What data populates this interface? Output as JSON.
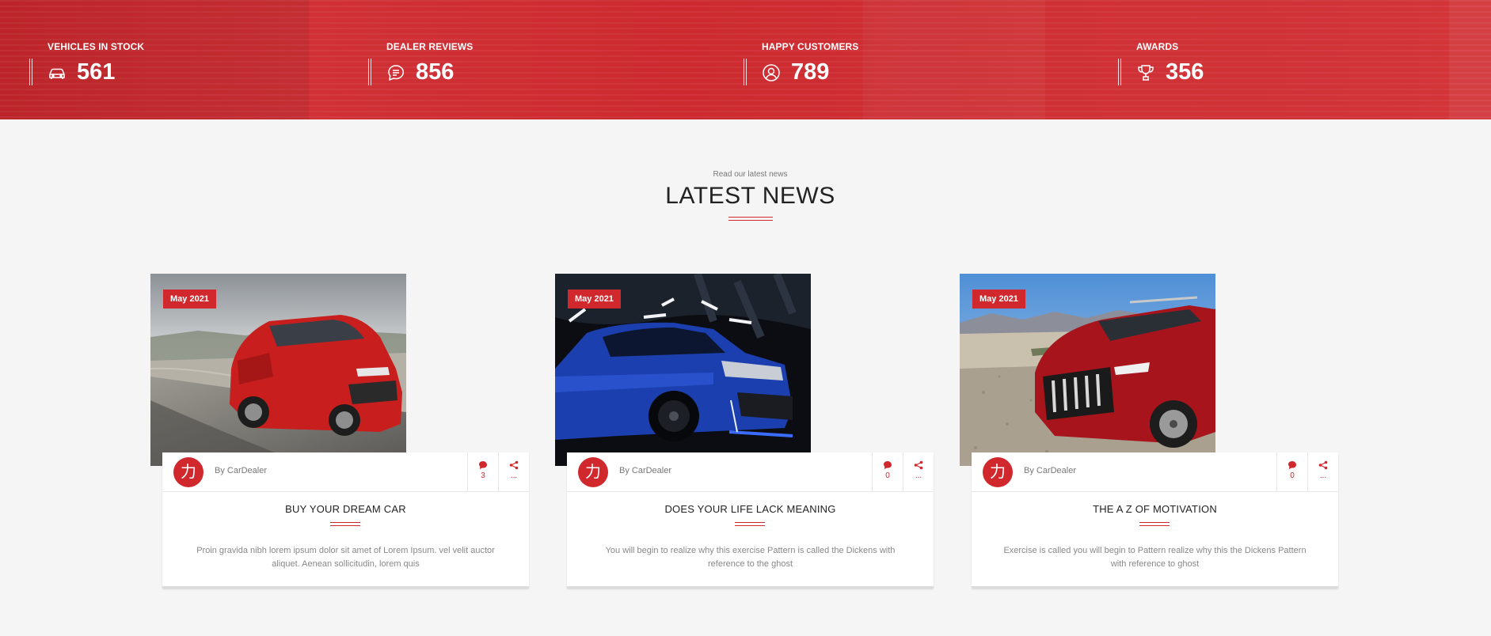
{
  "stats": [
    {
      "label": "VEHICLES IN STOCK",
      "value": "561",
      "icon": "car-icon"
    },
    {
      "label": "DEALER REVIEWS",
      "value": "856",
      "icon": "chat-icon"
    },
    {
      "label": "HAPPY CUSTOMERS",
      "value": "789",
      "icon": "user-icon"
    },
    {
      "label": "AWARDS",
      "value": "356",
      "icon": "trophy-icon"
    }
  ],
  "news": {
    "eyebrow": "Read our latest news",
    "heading": "LATEST NEWS",
    "accent_color": "#d0282d",
    "posts": [
      {
        "date": "May 2021",
        "avatar_glyph": "力",
        "author": "By CarDealer",
        "comments": "3",
        "share": "...",
        "title": "BUY YOUR DREAM CAR",
        "excerpt": "Proin gravida nibh lorem ipsum dolor sit amet of Lorem Ipsum. vel velit auctor aliquet. Aenean sollicitudin, lorem quis"
      },
      {
        "date": "May 2021",
        "avatar_glyph": "力",
        "author": "By CarDealer",
        "comments": "0",
        "share": "...",
        "title": "DOES YOUR LIFE LACK MEANING",
        "excerpt": "You will begin to realize why this exercise Pattern is called the Dickens with reference to the ghost"
      },
      {
        "date": "May 2021",
        "avatar_glyph": "力",
        "author": "By CarDealer",
        "comments": "0",
        "share": "...",
        "title": "THE A Z OF MOTIVATION",
        "excerpt": "Exercise is called you will begin to Pattern realize why this the Dickens Pattern with reference to ghost"
      }
    ]
  }
}
